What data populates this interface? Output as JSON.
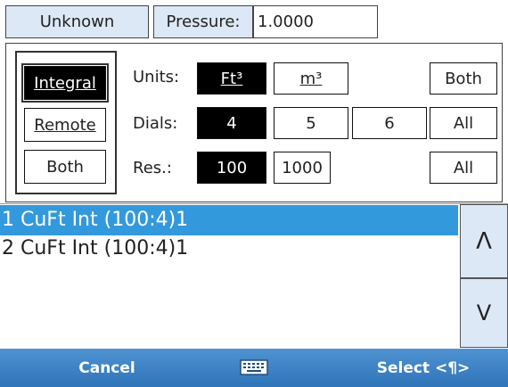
{
  "top": {
    "unknown_label": "Unknown",
    "pressure_label": "Pressure:",
    "pressure_value": "1.0000"
  },
  "mode": {
    "integral": "Integral",
    "remote": "Remote",
    "both": "Both"
  },
  "rows": {
    "units_label": "Units:",
    "units_ft3": "Ft³",
    "units_m3": "m³",
    "units_both": "Both",
    "dials_label": "Dials:",
    "dials_4": "4",
    "dials_5": "5",
    "dials_6": "6",
    "dials_all": "All",
    "res_label": "Res.:",
    "res_100": "100",
    "res_1000": "1000",
    "res_all": "All"
  },
  "list": {
    "items": [
      "1 CuFt Int (100:4)1",
      "2 CuFt Int (100:4)1"
    ],
    "up_arrow": "Λ",
    "down_arrow": "V"
  },
  "bottom": {
    "cancel": "Cancel",
    "select": "Select <¶>"
  },
  "colors": {
    "selection_blue": "#3399dd",
    "bottom_bar": "#3a82c4",
    "header_blue": "#dce8f6"
  }
}
